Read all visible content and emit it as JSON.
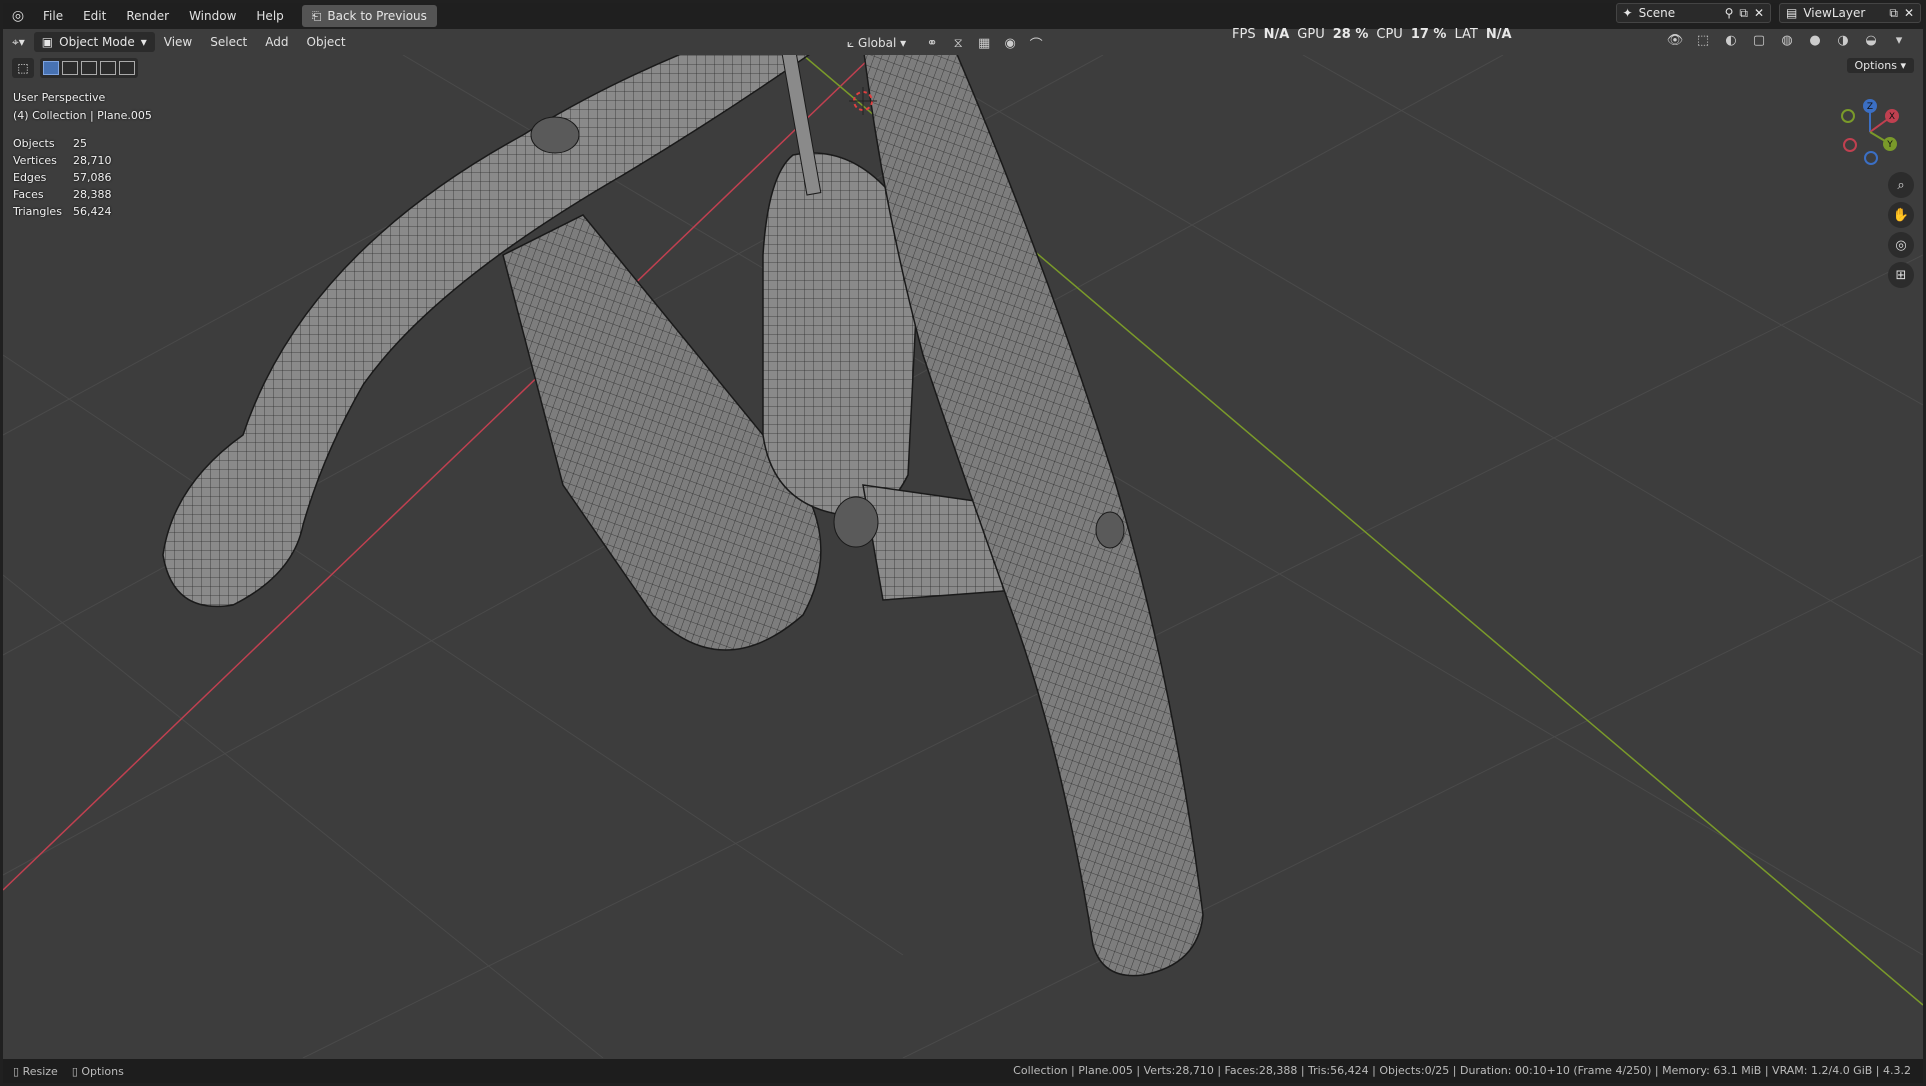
{
  "menu": {
    "items": [
      "File",
      "Edit",
      "Render",
      "Window",
      "Help"
    ],
    "back_button": "Back to Previous"
  },
  "scene": {
    "label": "Scene",
    "view_layer": "ViewLayer"
  },
  "header": {
    "mode": "Object Mode",
    "menus": [
      "View",
      "Select",
      "Add",
      "Object"
    ],
    "transform_orientation": "Global"
  },
  "perf": {
    "fps_label": "FPS",
    "fps_value": "N/A",
    "gpu_label": "GPU",
    "gpu_value": "28 %",
    "cpu_label": "CPU",
    "cpu_value": "17 %",
    "lat_label": "LAT",
    "lat_value": "N/A"
  },
  "options_label": "Options",
  "viewport_info": {
    "view": "User Perspective",
    "collection": "(4) Collection | Plane.005"
  },
  "stats": [
    {
      "key": "Objects",
      "value": "25"
    },
    {
      "key": "Vertices",
      "value": "28,710"
    },
    {
      "key": "Edges",
      "value": "57,086"
    },
    {
      "key": "Faces",
      "value": "28,388"
    },
    {
      "key": "Triangles",
      "value": "56,424"
    }
  ],
  "gizmo": {
    "x": "X",
    "y": "Y",
    "z": "Z"
  },
  "statusbar": {
    "resize": "Resize",
    "options": "Options",
    "info": "Collection | Plane.005 | Verts:28,710 | Faces:28,388 | Tris:56,424 | Objects:0/25 | Duration: 00:10+10 (Frame 4/250) | Memory: 63.1 MiB | VRAM: 1.2/4.0 GiB | 4.3.2"
  },
  "colors": {
    "x_axis": "#c04050",
    "y_axis": "#7a9a2a",
    "background": "#3d3d3d",
    "accent": "#4772b3"
  }
}
